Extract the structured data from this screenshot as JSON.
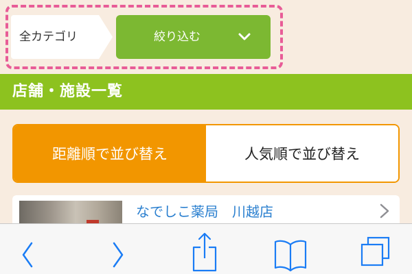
{
  "filter_bar": {
    "category_label": "全カテゴリ",
    "narrow_button_label": "絞り込む",
    "narrow_button_icon": "chevron-down-icon",
    "highlight_color": "#e85c97",
    "button_color": "#7cb832"
  },
  "section": {
    "title": "店舗・施設一覧",
    "color": "#8dc21f"
  },
  "sort": {
    "options": [
      {
        "label": "距離順で並び替え",
        "active": true
      },
      {
        "label": "人気順で並び替え",
        "active": false
      }
    ],
    "active_color": "#f29600"
  },
  "stores": [
    {
      "name": "なでしこ薬局　川越店"
    }
  ],
  "toolbar": {
    "icons": [
      "back-icon",
      "forward-icon",
      "share-icon",
      "bookmarks-icon",
      "tabs-icon"
    ],
    "accent": "#1a7cf5"
  }
}
